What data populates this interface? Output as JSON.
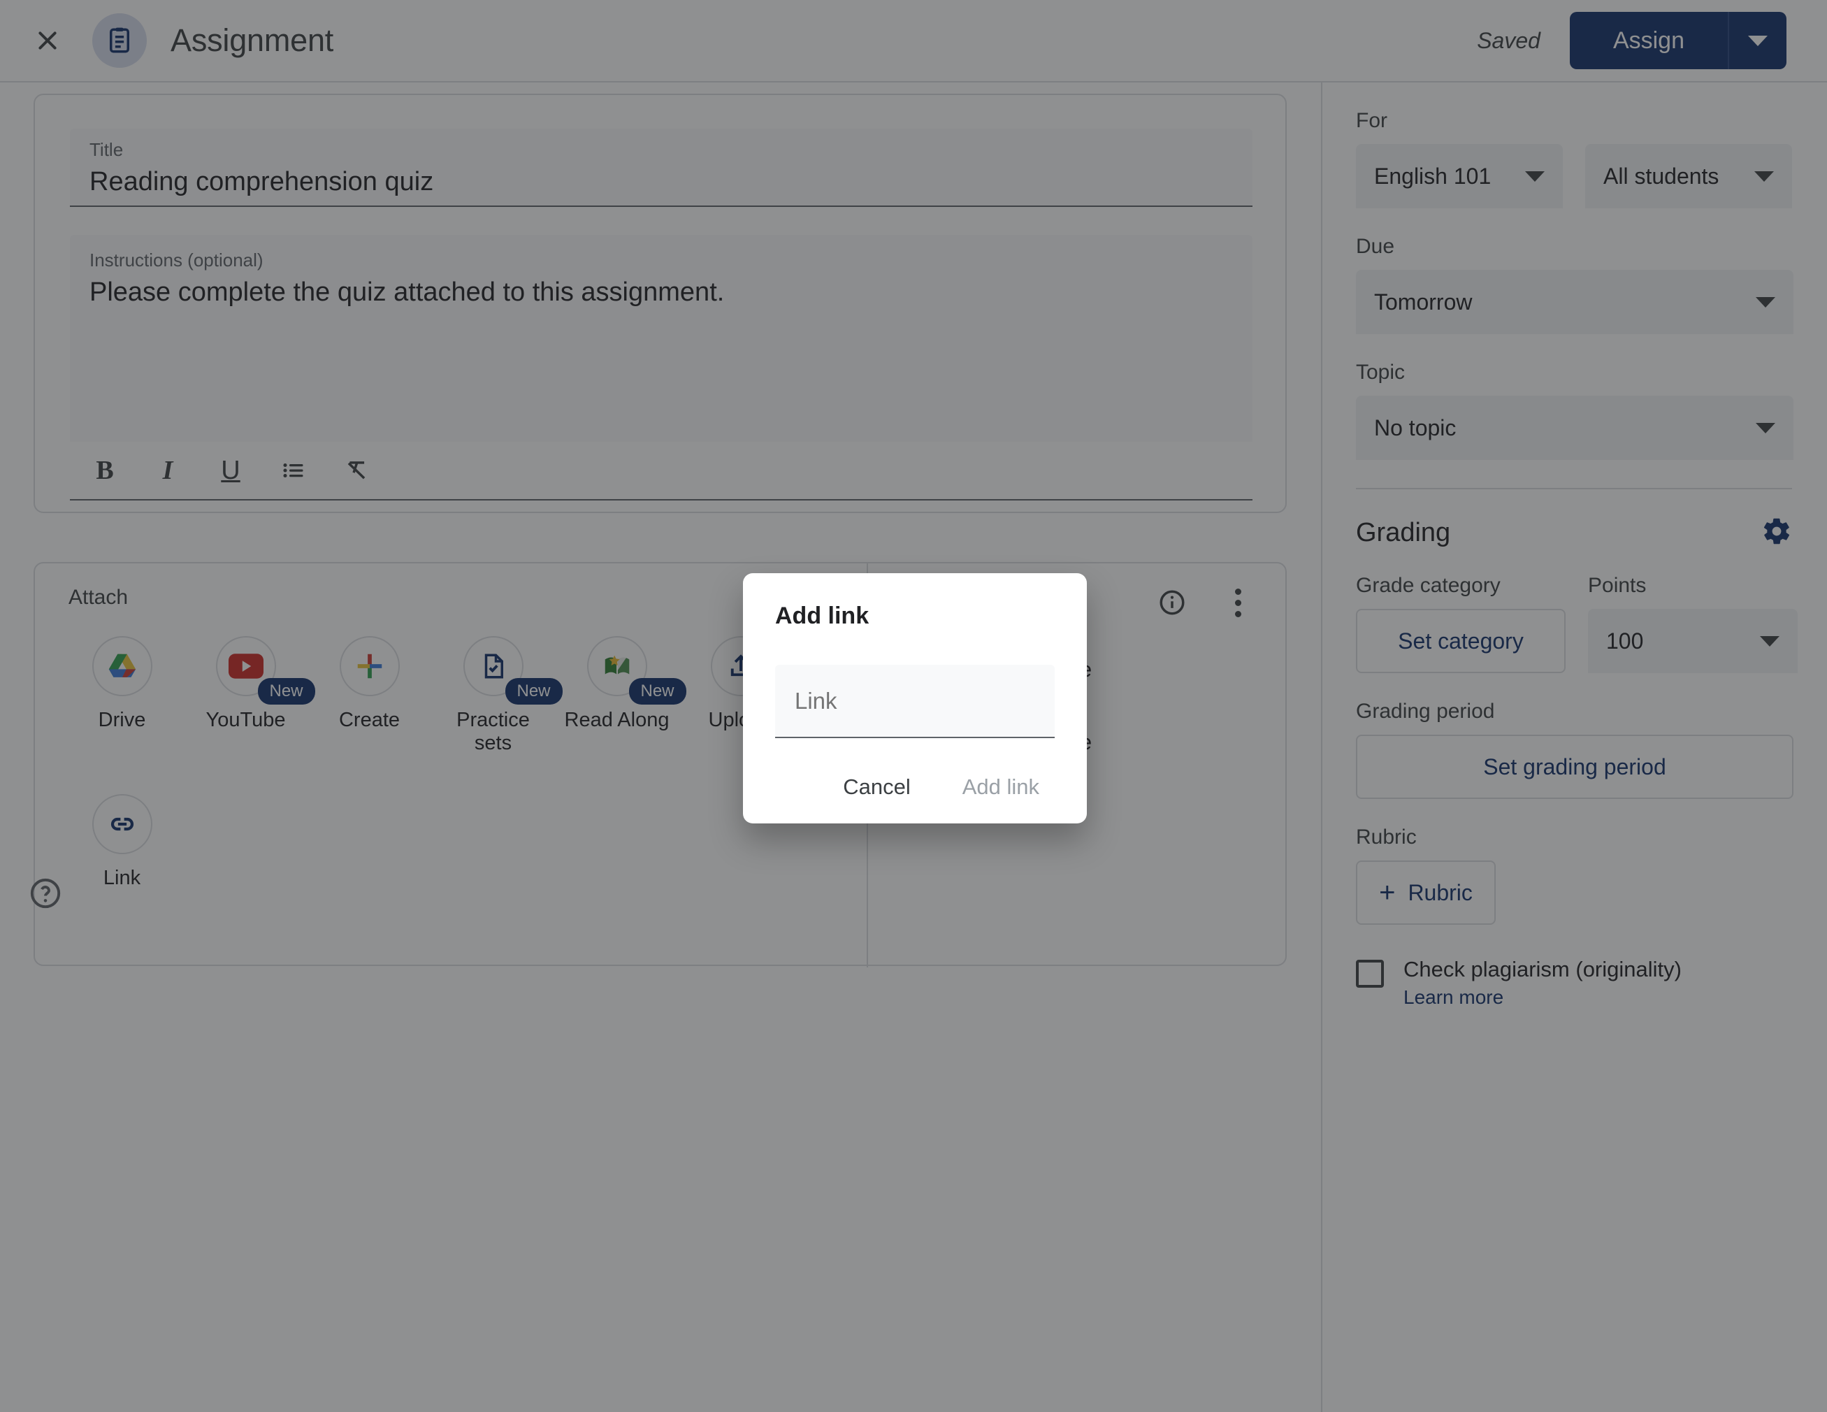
{
  "header": {
    "app_icon": "clipboard-icon",
    "title": "Assignment",
    "saved_status": "Saved",
    "assign_label": "Assign",
    "assign_caret": "chevron-down-icon",
    "close": "close-icon"
  },
  "details": {
    "title_label": "Title",
    "title_value": "Reading comprehension quiz",
    "instructions_label": "Instructions (optional)",
    "instructions_value": "Please complete the quiz attached to this assignment.",
    "toolbar": [
      {
        "name": "bold-icon",
        "glyph": "B"
      },
      {
        "name": "italic-icon",
        "glyph": "I"
      },
      {
        "name": "underline-icon",
        "glyph": "U"
      },
      {
        "name": "bulleted-list-icon",
        "glyph": "☰"
      },
      {
        "name": "clear-formatting-icon",
        "glyph": "T̶x"
      }
    ]
  },
  "attach": {
    "label": "Attach",
    "items": [
      {
        "label": "Drive",
        "icon": "google-drive-icon",
        "badge": ""
      },
      {
        "label": "YouTube",
        "icon": "youtube-icon",
        "badge": "New"
      },
      {
        "label": "Create",
        "icon": "create-plus-icon",
        "badge": ""
      },
      {
        "label": "Practice sets",
        "icon": "practice-sets-icon",
        "badge": "New"
      },
      {
        "label": "Read Along",
        "icon": "read-along-icon",
        "badge": "New"
      },
      {
        "label": "Upload",
        "icon": "upload-icon",
        "badge": ""
      }
    ],
    "row2": [
      {
        "label": "Link",
        "icon": "link-icon",
        "badge": ""
      }
    ],
    "info_icon": "info-icon",
    "more_icon": "more-vert-icon",
    "addons": [
      {
        "label": "Add-on name",
        "icon": "person-avatar"
      },
      {
        "label": "Add-on name",
        "icon": "person-avatar"
      }
    ]
  },
  "sidebar": {
    "for_label": "For",
    "course_value": "English 101",
    "students_value": "All students",
    "due_label": "Due",
    "due_value": "Tomorrow",
    "topic_label": "Topic",
    "topic_value": "No topic",
    "grading_title": "Grading",
    "grading_settings_icon": "gear-icon",
    "grade_category_label": "Grade category",
    "grade_category_button": "Set category",
    "points_label": "Points",
    "points_value": "100",
    "grading_period_label": "Grading period",
    "grading_period_button": "Set grading period",
    "rubric_label": "Rubric",
    "rubric_button": "Rubric",
    "plagiarism_label": "Check plagiarism (originality)",
    "plagiarism_link": "Learn more"
  },
  "modal": {
    "title": "Add link",
    "input_placeholder": "Link",
    "cancel_label": "Cancel",
    "confirm_label": "Add link"
  },
  "footer": {
    "help_icon": "help-circle-icon"
  },
  "colors": {
    "brand_blue": "#13306b",
    "text_primary": "#202124",
    "text_secondary": "#5f6368",
    "border": "#dadce0",
    "field_bg": "#f8f9fa"
  }
}
